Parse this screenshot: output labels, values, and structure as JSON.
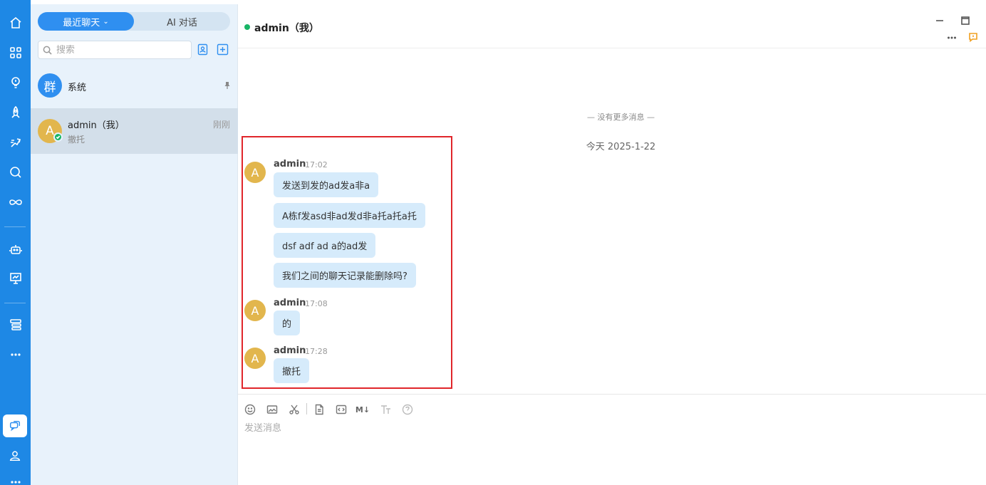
{
  "rail": {
    "icons": [
      "home-icon",
      "apps-grid-icon",
      "bulb-icon",
      "rocket-icon",
      "run-icon",
      "search-circle-icon",
      "infinity-icon",
      "robot-icon",
      "presentation-icon",
      "stack-icon",
      "more-icon",
      "chat-bubbles-icon",
      "contact-icon"
    ]
  },
  "list": {
    "tabs": [
      {
        "label": "最近聊天",
        "active": true
      },
      {
        "label": "AI 对话",
        "active": false
      }
    ],
    "search_placeholder": "搜索",
    "conversations": [
      {
        "avatar_text": "群",
        "name": "系统",
        "pinned": true
      },
      {
        "avatar_text": "A",
        "name": "admin（我）",
        "last_message": "撤托",
        "time": "刚刚",
        "selected": true
      }
    ]
  },
  "chat": {
    "title": "admin（我）",
    "no_more": "— 没有更多消息 —",
    "date_separator": "今天 2025-1-22",
    "groups": [
      {
        "avatar_text": "A",
        "author": "admin",
        "time": "17:02",
        "messages": [
          "发送到发的ad发a非a",
          "A栋f发asd非ad发d非a托a托a托",
          " dsf adf ad a的ad发",
          "我们之间的聊天记录能删除吗?"
        ]
      },
      {
        "avatar_text": "A",
        "author": "admin",
        "time": "17:08",
        "messages": [
          "的"
        ]
      },
      {
        "avatar_text": "A",
        "author": "admin",
        "time": "17:28",
        "messages": [
          "撤托"
        ]
      }
    ],
    "composer": {
      "placeholder": "发送消息",
      "markdown_label": "M↓",
      "tools": [
        "emoji-icon",
        "image-icon",
        "scissors-icon",
        "file-icon",
        "code-icon",
        "markdown-icon",
        "text-size-icon",
        "help-icon"
      ]
    }
  },
  "colors": {
    "rail": "#1e88e5",
    "accent": "#2f8ff0",
    "bubble": "#d6ebfb",
    "online": "#18b566",
    "highlight": "#e0262b",
    "avatar_gold": "#e2b64d"
  }
}
